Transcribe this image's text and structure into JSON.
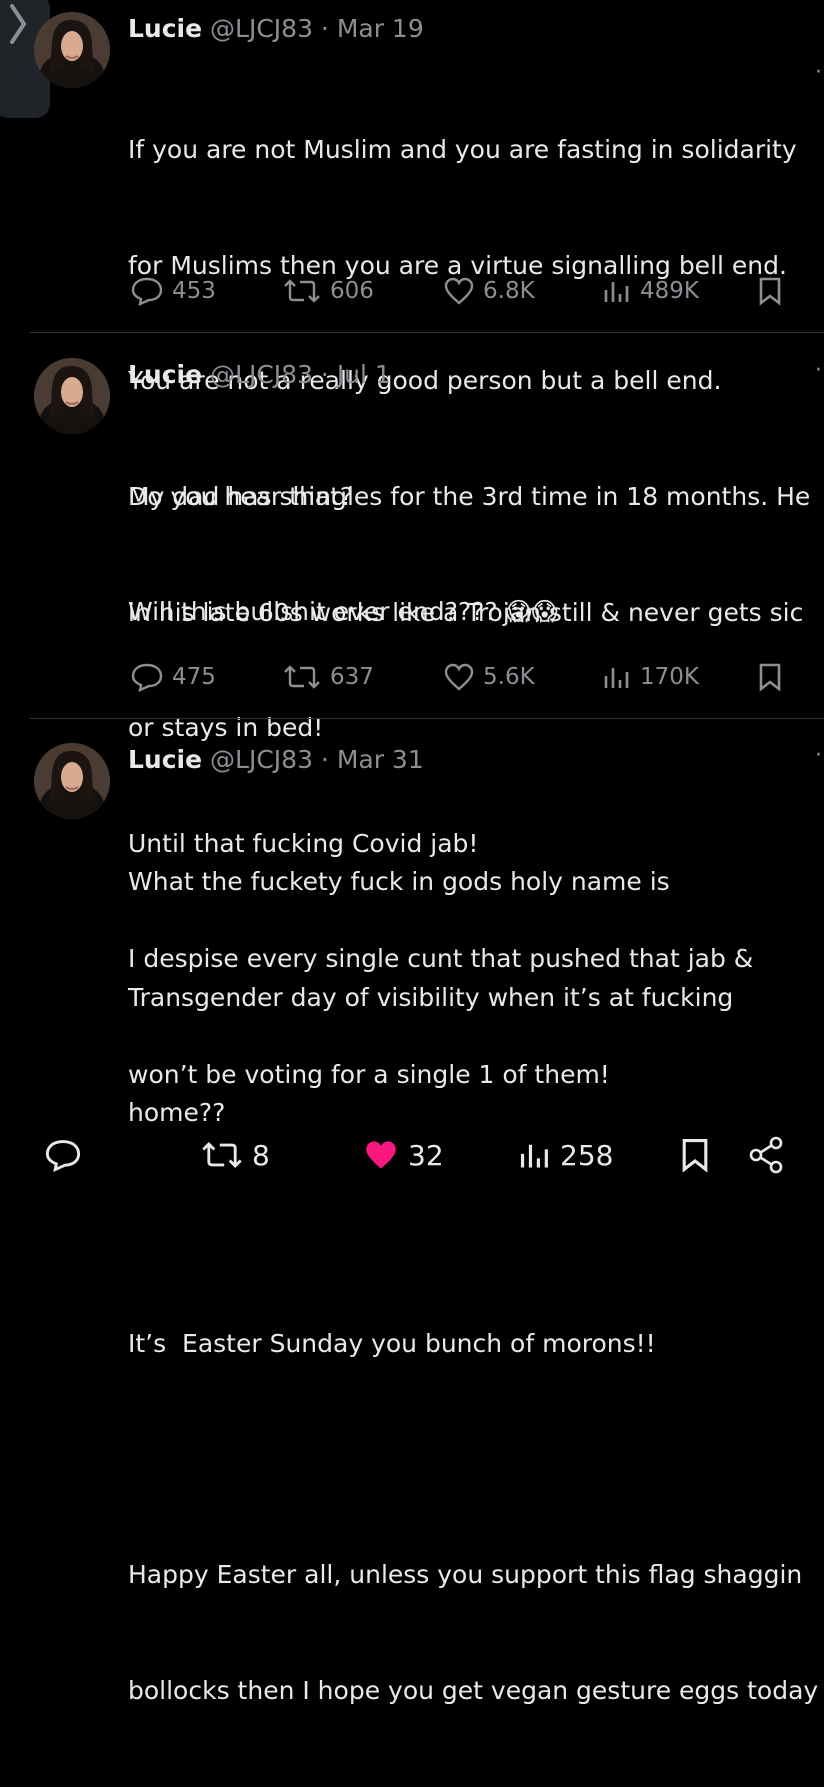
{
  "tweets": [
    {
      "name": "Lucie",
      "handle": "@LJCJ83",
      "date": "Mar 19",
      "meta": "@LJCJ83 · Mar 19",
      "lines": [
        "If you are not Muslim and you are fasting in solidarity",
        "for Muslims then you are a virtue signalling bell end.",
        "You are not a really good person but a bell end.",
        "Do you hear that?",
        "Will this bullshit ever end???? 😱😱"
      ],
      "replies": "453",
      "reposts": "606",
      "likes": "6.8K",
      "views": "489K"
    },
    {
      "name": "Lucie",
      "handle": "@LJCJ83",
      "date": "Jul 1",
      "meta": "@LJCJ83 · Jul 1",
      "lines": [
        "My dad has shingles for the 3rd time in 18 months. He",
        "in his late 60s works like a Trojan still & never gets sic",
        "or stays in bed!",
        "Until that fucking Covid jab!",
        "I despise every single cunt that pushed that jab &",
        "won’t be voting for a single 1 of them!"
      ],
      "replies": "475",
      "reposts": "637",
      "likes": "5.6K",
      "views": "170K"
    },
    {
      "name": "Lucie",
      "handle": "@LJCJ83",
      "date": "Mar 31",
      "meta": "@LJCJ83 · Mar 31",
      "lines": [
        "What the fuckety fuck in gods holy name is",
        "Transgender day of visibility when it’s at fucking",
        "home??",
        "",
        "It’s  Easter Sunday you bunch of morons!!",
        "",
        "Happy Easter all, unless you support this flag shaggin",
        "bollocks then I hope you get vegan gesture eggs today"
      ]
    }
  ],
  "bottom_bar": {
    "reposts": "8",
    "likes": "32",
    "views": "258",
    "like_color": "#f91880"
  },
  "icons": [
    "chevron-right-icon",
    "reply-icon",
    "repost-icon",
    "like-icon",
    "views-icon",
    "bookmark-icon",
    "share-icon"
  ]
}
